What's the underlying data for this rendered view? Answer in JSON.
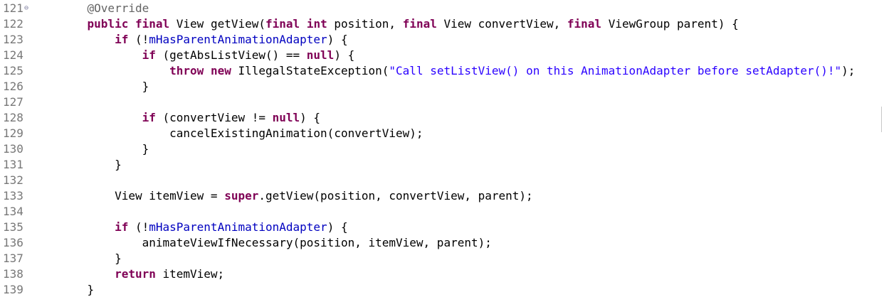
{
  "editor": {
    "lines": [
      {
        "n": "121",
        "fold": "⊖",
        "tokens": [
          [
            "ann",
            "    @Override"
          ]
        ]
      },
      {
        "n": "122",
        "tokens": [
          [
            "plain",
            "    "
          ],
          [
            "kw",
            "public"
          ],
          [
            "plain",
            " "
          ],
          [
            "kw",
            "final"
          ],
          [
            "plain",
            " View getView("
          ],
          [
            "kw",
            "final"
          ],
          [
            "plain",
            " "
          ],
          [
            "kw",
            "int"
          ],
          [
            "plain",
            " position, "
          ],
          [
            "kw",
            "final"
          ],
          [
            "plain",
            " View convertView, "
          ],
          [
            "kw",
            "final"
          ],
          [
            "plain",
            " ViewGroup parent) {"
          ]
        ]
      },
      {
        "n": "123",
        "tokens": [
          [
            "plain",
            "        "
          ],
          [
            "kw",
            "if"
          ],
          [
            "plain",
            " (!"
          ],
          [
            "field",
            "mHasParentAnimationAdapter"
          ],
          [
            "plain",
            ") {"
          ]
        ]
      },
      {
        "n": "124",
        "tokens": [
          [
            "plain",
            "            "
          ],
          [
            "kw",
            "if"
          ],
          [
            "plain",
            " (getAbsListView() == "
          ],
          [
            "kw",
            "null"
          ],
          [
            "plain",
            ") {"
          ]
        ]
      },
      {
        "n": "125",
        "tokens": [
          [
            "plain",
            "                "
          ],
          [
            "kw",
            "throw"
          ],
          [
            "plain",
            " "
          ],
          [
            "kw",
            "new"
          ],
          [
            "plain",
            " IllegalStateException("
          ],
          [
            "str",
            "\"Call setListView() on this AnimationAdapter before setAdapter()!\""
          ],
          [
            "plain",
            ");"
          ]
        ]
      },
      {
        "n": "126",
        "tokens": [
          [
            "plain",
            "            }"
          ]
        ]
      },
      {
        "n": "127",
        "tokens": []
      },
      {
        "n": "128",
        "tokens": [
          [
            "plain",
            "            "
          ],
          [
            "kw",
            "if"
          ],
          [
            "plain",
            " (convertView != "
          ],
          [
            "kw",
            "null"
          ],
          [
            "plain",
            ") {"
          ]
        ]
      },
      {
        "n": "129",
        "tokens": [
          [
            "plain",
            "                cancelExistingAnimation(convertView);"
          ]
        ]
      },
      {
        "n": "130",
        "tokens": [
          [
            "plain",
            "            }"
          ]
        ]
      },
      {
        "n": "131",
        "tokens": [
          [
            "plain",
            "        }"
          ]
        ]
      },
      {
        "n": "132",
        "tokens": []
      },
      {
        "n": "133",
        "tokens": [
          [
            "plain",
            "        View itemView = "
          ],
          [
            "kw",
            "super"
          ],
          [
            "plain",
            ".getView(position, convertView, parent);"
          ]
        ]
      },
      {
        "n": "134",
        "tokens": []
      },
      {
        "n": "135",
        "tokens": [
          [
            "plain",
            "        "
          ],
          [
            "kw",
            "if"
          ],
          [
            "plain",
            " (!"
          ],
          [
            "field",
            "mHasParentAnimationAdapter"
          ],
          [
            "plain",
            ") {"
          ]
        ]
      },
      {
        "n": "136",
        "tokens": [
          [
            "plain",
            "            animateViewIfNecessary(position, itemView, parent);"
          ]
        ]
      },
      {
        "n": "137",
        "tokens": [
          [
            "plain",
            "        }"
          ]
        ]
      },
      {
        "n": "138",
        "tokens": [
          [
            "plain",
            "        "
          ],
          [
            "kw",
            "return"
          ],
          [
            "plain",
            " itemView;"
          ]
        ]
      },
      {
        "n": "139",
        "tokens": [
          [
            "plain",
            "    }"
          ]
        ]
      }
    ]
  },
  "colors": {
    "keyword": "#7f0055",
    "field": "#0000c0",
    "string": "#2a00ff",
    "annotation": "#646464",
    "line_number": "#787878",
    "background": "#ffffff"
  }
}
